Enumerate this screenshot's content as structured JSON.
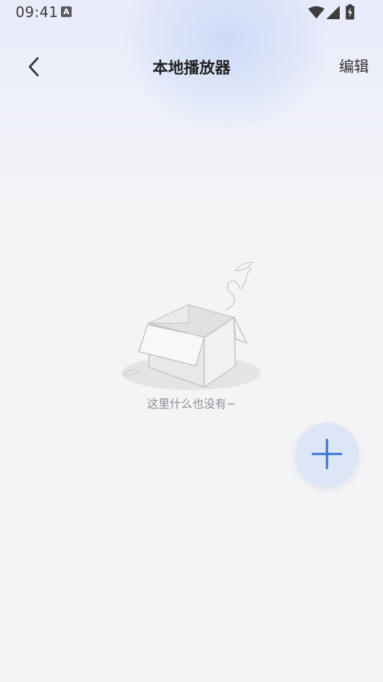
{
  "status_bar": {
    "time": "09:41",
    "notification_icon_letter": "A"
  },
  "header": {
    "title": "本地播放器",
    "edit_label": "编辑"
  },
  "empty_state": {
    "message": "这里什么也没有~"
  },
  "colors": {
    "background": "#f3f4f6",
    "accent": "#2f6fde",
    "fab_background": "#dde6f6"
  },
  "icons": {
    "back": "chevron-left-icon",
    "add": "plus-icon",
    "illustration": "empty-box-icon"
  }
}
